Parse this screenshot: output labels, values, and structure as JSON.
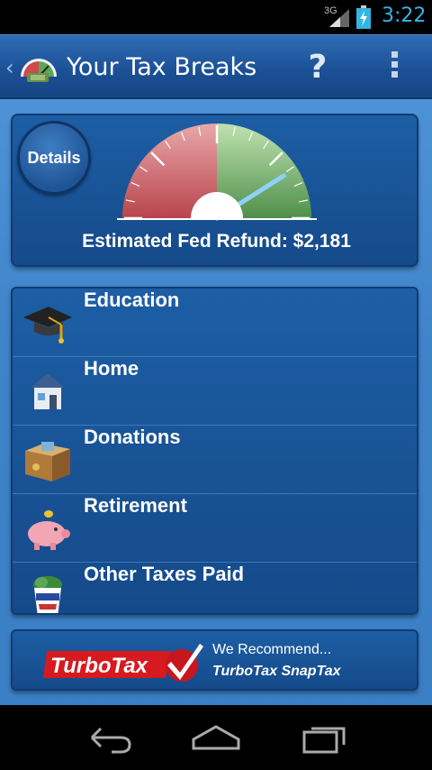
{
  "status_bar": {
    "network": "3G",
    "time": "3:22",
    "icons": [
      "signal-icon",
      "battery-charging-icon"
    ]
  },
  "action_bar": {
    "title": "Your Tax Breaks",
    "back_icon": "chevron-left-icon",
    "logo_icon": "tax-gauge-logo-icon",
    "help_label": "?",
    "overflow_icon": "overflow-menu-icon"
  },
  "gauge_card": {
    "details_label": "Details",
    "refund_label": "Estimated Fed Refund: $2,181",
    "gauge_level": 0.82,
    "colors": {
      "red_zone": "#c0505a",
      "green_zone": "#5c9a55",
      "needle": "#8fd0ff"
    }
  },
  "menu": {
    "items": [
      {
        "label": "Education",
        "icon": "graduation-cap-icon"
      },
      {
        "label": "Home",
        "icon": "house-icon"
      },
      {
        "label": "Donations",
        "icon": "donation-box-icon"
      },
      {
        "label": "Retirement",
        "icon": "piggy-bank-icon"
      },
      {
        "label": "Other Taxes Paid",
        "icon": "uncle-sam-hat-money-icon"
      }
    ]
  },
  "promo": {
    "brand": "TurboTax",
    "recommend": "We Recommend...",
    "product": "TurboTax SnapTax",
    "brand_color": "#d71920"
  },
  "nav_bar": {
    "icons": [
      "back-icon",
      "home-icon",
      "recent-apps-icon"
    ]
  },
  "colors": {
    "accent": "#33b5e5",
    "panel": "#1a5598",
    "background": "#3f83c9"
  }
}
